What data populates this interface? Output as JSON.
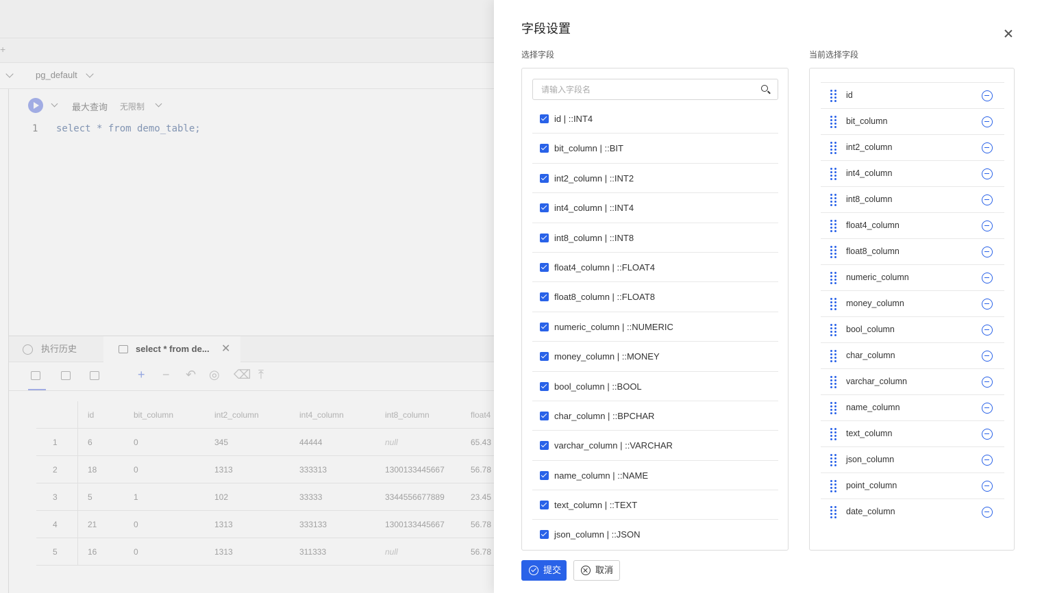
{
  "background": {
    "plus": "+",
    "db_name": "pg_default",
    "editor": {
      "max_query_label": "最大查询",
      "limit_value": "无限制",
      "line_number": "1",
      "code": "select * from demo_table;"
    },
    "result_tabs": [
      {
        "label": "执行历史"
      },
      {
        "label": "select * from de..."
      }
    ],
    "tab_close": "✕",
    "toolbar_glyphs": {
      "add": "+",
      "remove": "−",
      "undo": "↶",
      "view": "◎",
      "clear": "⌫",
      "export": "⤒"
    },
    "table": {
      "columns": [
        "id",
        "bit_column",
        "int2_column",
        "int4_column",
        "int8_column",
        "float4"
      ],
      "rows": [
        [
          "1",
          "6",
          "0",
          "345",
          "44444",
          "null",
          "65.43"
        ],
        [
          "2",
          "18",
          "0",
          "1313",
          "333313",
          "1300133445667",
          "56.78"
        ],
        [
          "3",
          "5",
          "1",
          "102",
          "33333",
          "3344556677889",
          "23.45"
        ],
        [
          "4",
          "21",
          "0",
          "1313",
          "333133",
          "1300133445667",
          "56.78"
        ],
        [
          "5",
          "16",
          "0",
          "1313",
          "311333",
          "null",
          "56.78"
        ]
      ]
    }
  },
  "drawer": {
    "title": "字段设置",
    "left_label": "选择字段",
    "right_label": "当前选择字段",
    "search_placeholder": "请输入字段名",
    "fields": [
      "id | ::INT4",
      "bit_column | ::BIT",
      "int2_column | ::INT2",
      "int4_column | ::INT4",
      "int8_column | ::INT8",
      "float4_column | ::FLOAT4",
      "float8_column | ::FLOAT8",
      "numeric_column | ::NUMERIC",
      "money_column | ::MONEY",
      "bool_column | ::BOOL",
      "char_column | ::BPCHAR",
      "varchar_column | ::VARCHAR",
      "name_column | ::NAME",
      "text_column | ::TEXT",
      "json_column | ::JSON"
    ],
    "selected": [
      "id",
      "bit_column",
      "int2_column",
      "int4_column",
      "int8_column",
      "float4_column",
      "float8_column",
      "numeric_column",
      "money_column",
      "bool_column",
      "char_column",
      "varchar_column",
      "name_column",
      "text_column",
      "json_column",
      "point_column",
      "date_column"
    ],
    "submit_label": "提交",
    "cancel_label": "取消"
  },
  "colors": {
    "accent": "#2962e8"
  }
}
